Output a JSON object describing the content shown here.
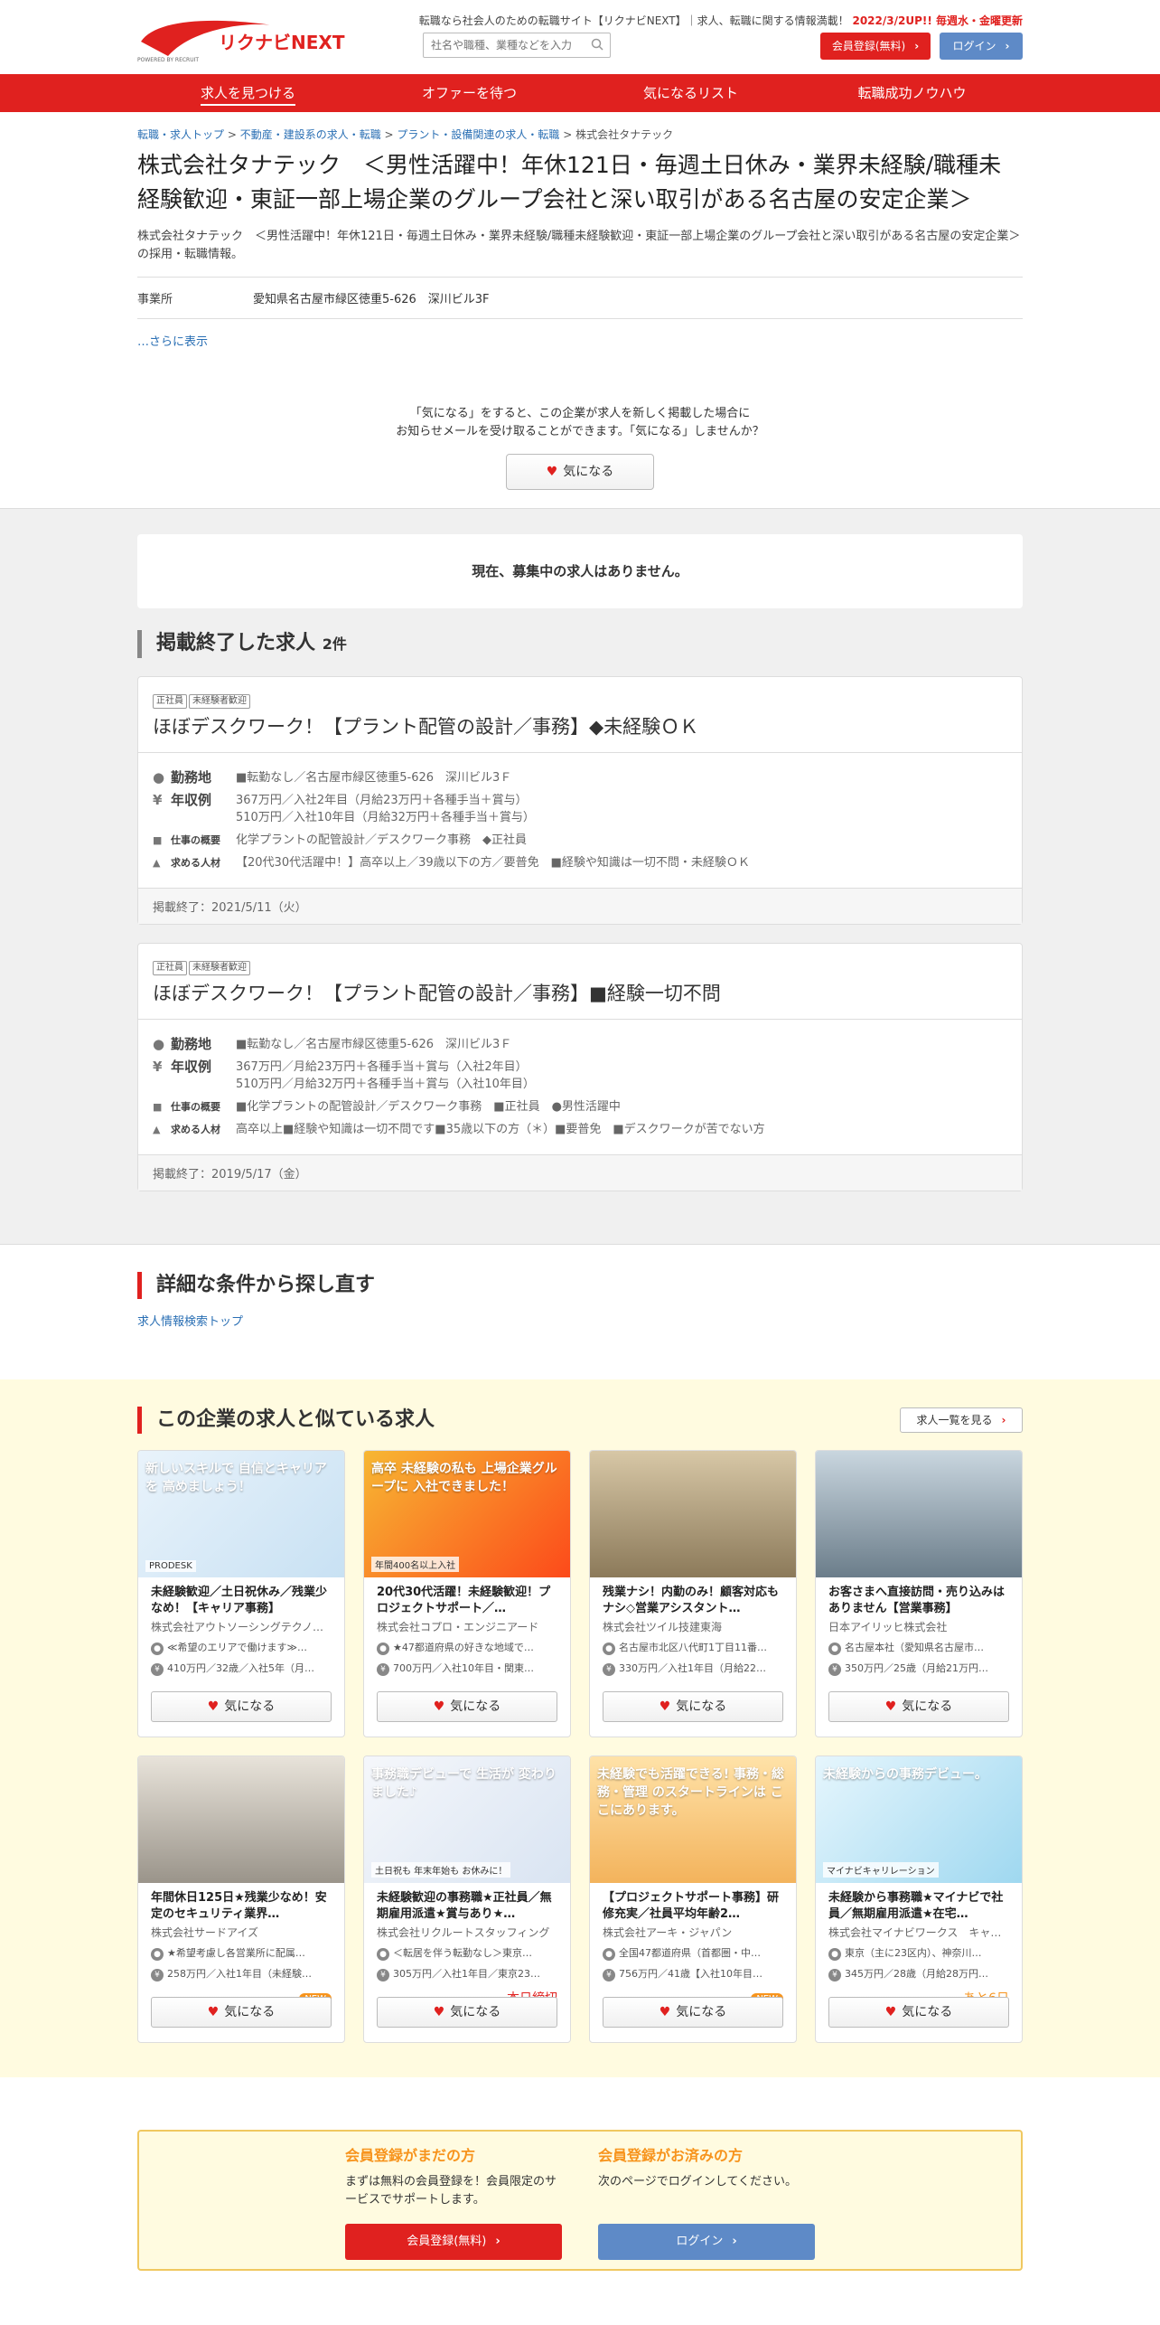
{
  "header": {
    "tagline_pre": "転職なら社会人のための転職サイト【リクナビNEXT】｜求人、転職に関する情報満載！",
    "tagline_hl": "2022/3/2UP!! 毎週水・金曜更新",
    "logo_text": "リクナビNEXT",
    "logo_sub": "POWERED BY RECRUIT",
    "search_placeholder": "社名や職種、業種などを入力",
    "register": "会員登録(無料)",
    "login": "ログイン"
  },
  "nav": [
    "求人を見つける",
    "オファーを待つ",
    "気になるリスト",
    "転職成功ノウハウ"
  ],
  "breadcrumb": [
    "転職・求人トップ",
    "不動産・建設系の求人・転職",
    "プラント・設備関連の求人・転職",
    "株式会社タナテック"
  ],
  "company": {
    "title": "株式会社タナテック　＜男性活躍中！年休121日・毎週土日休み・業界未経験/職種未経験歓迎・東証一部上場企業のグループ会社と深い取引がある名古屋の安定企業＞",
    "subtitle": "株式会社タナテック　＜男性活躍中！年休121日・毎週土日休み・業界未経験/職種未経験歓迎・東証一部上場企業のグループ会社と深い取引がある名古屋の安定企業＞の採用・転職情報。",
    "office_label": "事業所",
    "office_value": "愛知県名古屋市緑区徳重5-626　深川ビル3F",
    "more": "…さらに表示"
  },
  "favorite": {
    "line1": "「気になる」をすると、この企業が求人を新しく掲載した場合に",
    "line2": "お知らせメールを受け取ることができます。「気になる」しませんか？",
    "button": "気になる"
  },
  "no_jobs": "現在、募集中の求人はありません。",
  "ended": {
    "heading": "掲載終了した求人",
    "count": "2件",
    "jobs": [
      {
        "tags": [
          "正社員",
          "未経験者歓迎"
        ],
        "title": "ほぼデスクワーク！【プラント配管の設計／事務】◆未経験ＯＫ",
        "loc_label": "勤務地",
        "loc": "■転勤なし／名古屋市緑区徳重5-626　深川ビル3Ｆ",
        "pay_label": "年収例",
        "pay1": "367万円／入社2年目（月給23万円＋各種手当＋賞与）",
        "pay2": "510万円／入社10年目（月給32万円＋各種手当＋賞与）",
        "work_label": "仕事の概要",
        "work": "化学プラントの配管設計／デスクワーク事務　◆正社員",
        "req_label": "求める人材",
        "req": "【20代30代活躍中！】高卒以上／39歳以下の方／要普免　■経験や知識は一切不問・未経験ＯＫ",
        "end": "掲載終了：2021/5/11（火）"
      },
      {
        "tags": [
          "正社員",
          "未経験者歓迎"
        ],
        "title": "ほぼデスクワーク！【プラント配管の設計／事務】■経験一切不問",
        "loc_label": "勤務地",
        "loc": "■転勤なし／名古屋市緑区徳重5-626　深川ビル3Ｆ",
        "pay_label": "年収例",
        "pay1": "367万円／月給23万円＋各種手当＋賞与（入社2年目）",
        "pay2": "510万円／月給32万円＋各種手当＋賞与（入社10年目）",
        "work_label": "仕事の概要",
        "work": "■化学プラントの配管設計／デスクワーク事務　■正社員　●男性活躍中",
        "req_label": "求める人材",
        "req": "高卒以上■経験や知識は一切不問です■35歳以下の方（＊）■要普免　■デスクワークが苦でない方",
        "end": "掲載終了：2019/5/17（金）"
      }
    ]
  },
  "research": {
    "heading": "詳細な条件から探し直す",
    "link": "求人情報検索トップ"
  },
  "similar": {
    "heading": "この企業の求人と似ている求人",
    "list_button": "求人一覧を見る",
    "fav_label": "気になる",
    "cards": [
      {
        "title": "未経験歓迎／土日祝休み／残業少なめ！【キャリア事務】",
        "company": "株式会社アウトソーシングテクノロジー",
        "loc": "≪希望のエリアで働けます≫…",
        "pay": "410万円／32歳／入社5年（月…",
        "badge": "",
        "badge_type": "",
        "img_text": "新しいスキルで 自信とキャリアを 高めましょう！",
        "img_sub": "PRODESK"
      },
      {
        "title": "20代30代活躍！未経験歓迎！プロジェクトサポート／…",
        "company": "株式会社コプロ・エンジニアード",
        "loc": "★47都道府県の好きな地域で…",
        "pay": "700万円／入社10年目・関東…",
        "badge": "",
        "badge_type": "",
        "img_text": "高卒 未経験の私も 上場企業グループに 入社できました！",
        "img_sub": "年間400名以上入社"
      },
      {
        "title": "残業ナシ！内勤のみ！顧客対応もナシ◇営業アシスタント…",
        "company": "株式会社ツイル技建東海",
        "loc": "名古屋市北区八代町1丁目11番…",
        "pay": "330万円／入社1年目（月給22…",
        "badge": "",
        "badge_type": "",
        "img_text": "",
        "img_sub": ""
      },
      {
        "title": "お客さまへ直接訪問・売り込みはありません【営業事務】",
        "company": "日本アイリッヒ株式会社",
        "loc": "名古屋本社（愛知県名古屋市…",
        "pay": "350万円／25歳（月給21万円…",
        "badge": "",
        "badge_type": "",
        "img_text": "",
        "img_sub": ""
      },
      {
        "title": "年間休日125日★残業少なめ！安定のセキュリティ業界…",
        "company": "株式会社サードアイズ",
        "loc": "★希望考慮し各営業所に配属…",
        "pay": "258万円／入社1年目（未経験…",
        "badge": "NEW",
        "badge_type": "new",
        "img_text": "",
        "img_sub": ""
      },
      {
        "title": "未経験歓迎の事務職★正社員／無期雇用派遣★賞与あり★…",
        "company": "株式会社リクルートスタッフィング",
        "loc": "＜転居を伴う転勤なし＞東京…",
        "pay": "305万円／入社1年目／東京23…",
        "badge": "本日締切",
        "badge_type": "red",
        "img_text": "事務職デビューで 生活が 変わりました♪",
        "img_sub": "土日祝も 年末年始も お休みに！"
      },
      {
        "title": "【プロジェクトサポート事務】研修充実／社員平均年齢2…",
        "company": "株式会社アーキ・ジャパン",
        "loc": "全国47都道府県（首都圏・中…",
        "pay": "756万円／41歳【入社10年目…",
        "badge": "NEW",
        "badge_type": "new",
        "img_text": "未経験でも活躍できる! 事務・総務・管理 のスタートラインは ここにあります。",
        "img_sub": ""
      },
      {
        "title": "未経験から事務職★マイナビで社員／無期雇用派遣★在宅…",
        "company": "株式会社マイナビワークス　キャ…",
        "loc": "東京（主に23区内）、神奈川…",
        "pay": "345万円／28歳（月給28万円…",
        "badge": "あと6日",
        "badge_type": "orange",
        "img_text": "未経験からの事務デビュー。",
        "img_sub": "マイナビキャリレーション"
      }
    ]
  },
  "bottom": {
    "left_h": "会員登録がまだの方",
    "left_p": "まずは無料の会員登録を！会員限定のサービスでサポートします。",
    "left_btn": "会員登録(無料)",
    "right_h": "会員登録がお済みの方",
    "right_p": "次のページでログインしてください。",
    "right_btn": "ログイン"
  },
  "colors": {
    "brand": "#e0211f",
    "blue": "#5e8ac7",
    "orange": "#f7941d",
    "bg_yellow": "#fffbe0"
  }
}
